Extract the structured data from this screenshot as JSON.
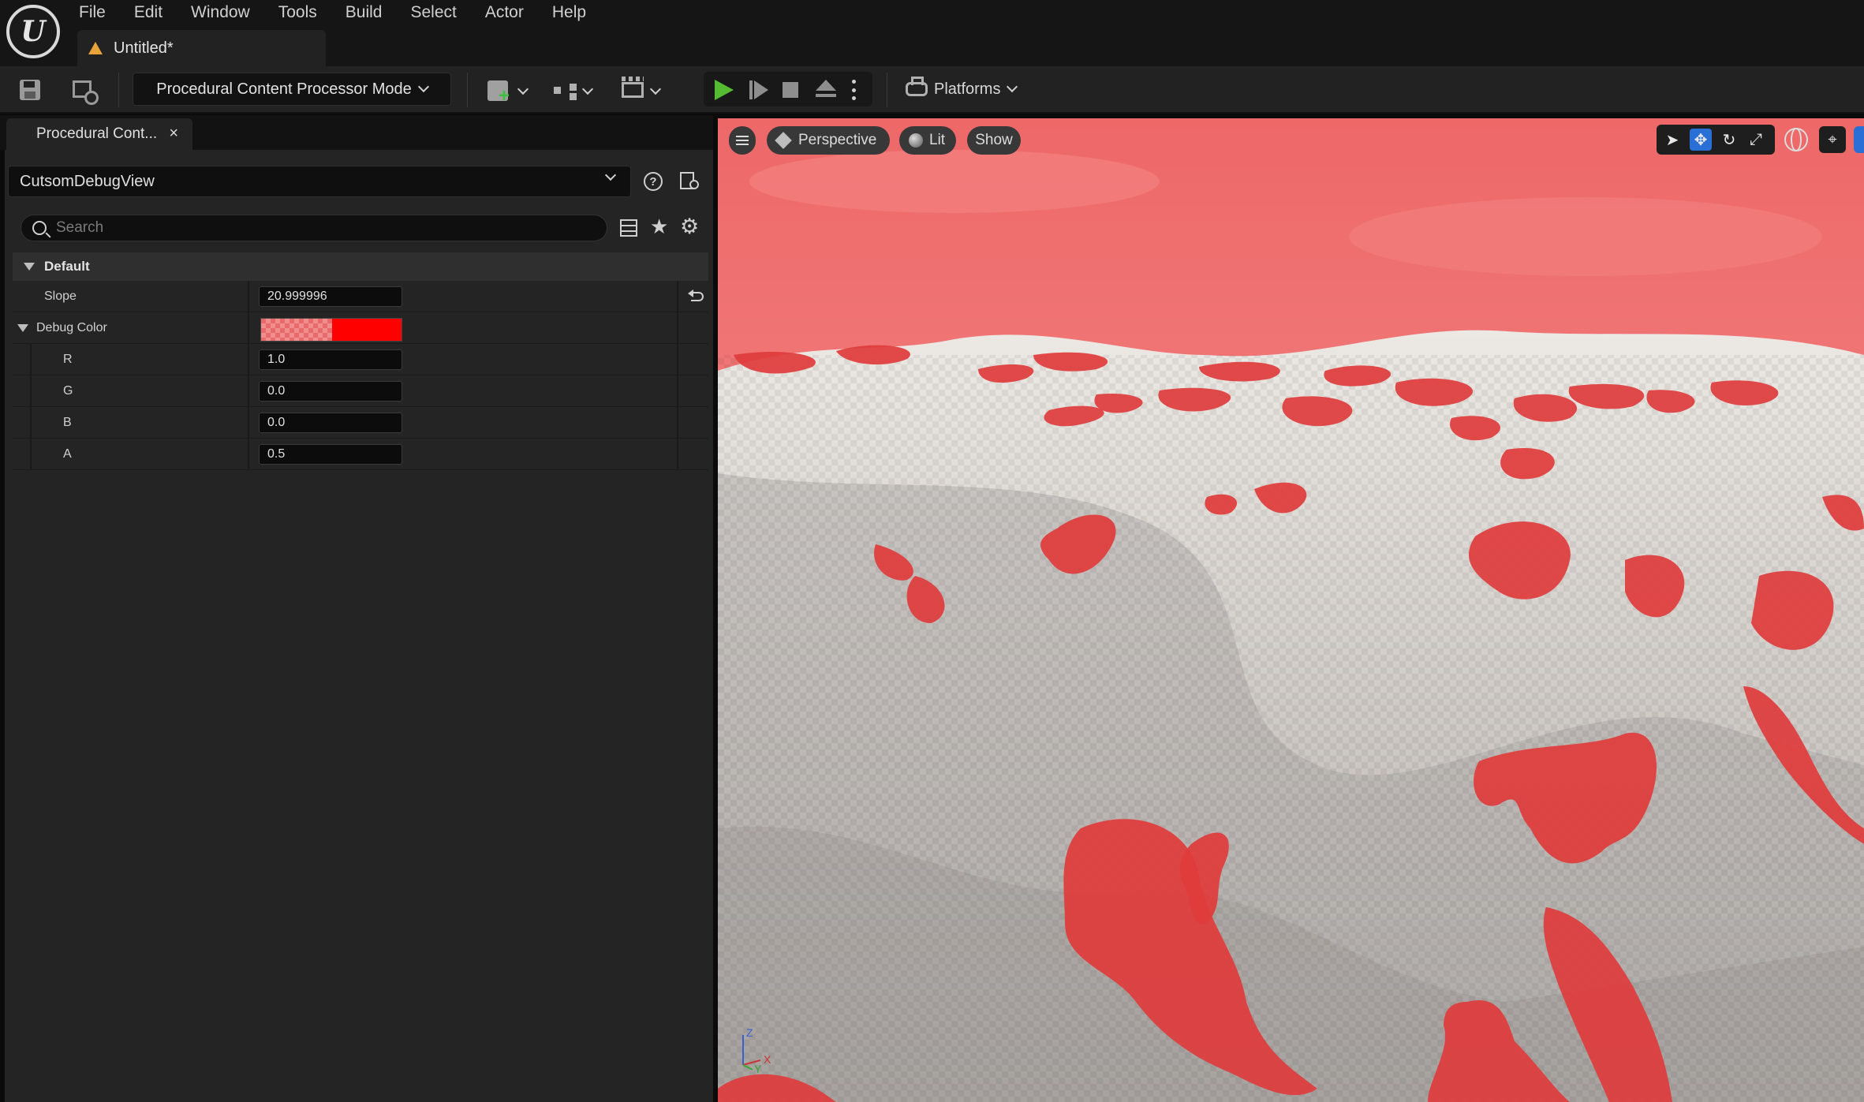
{
  "app": {
    "logo_text": "U",
    "menu": [
      "File",
      "Edit",
      "Window",
      "Tools",
      "Build",
      "Select",
      "Actor",
      "Help"
    ],
    "document_tab": "Untitled*"
  },
  "toolbar": {
    "mode_label": "Procedural Content Processor Mode",
    "platforms_label": "Platforms"
  },
  "panel": {
    "tab_label": "Procedural Cont...",
    "tab_close": "×",
    "object_name": "CutsomDebugView",
    "help_glyph": "?",
    "search_placeholder": "Search",
    "category": "Default",
    "properties": {
      "slope": {
        "label": "Slope",
        "value": "20.999996"
      },
      "debug_color": {
        "label": "Debug Color",
        "swatch_color": "#ff0000",
        "r": {
          "label": "R",
          "value": "1.0"
        },
        "g": {
          "label": "G",
          "value": "0.0"
        },
        "b": {
          "label": "B",
          "value": "0.0"
        },
        "a": {
          "label": "A",
          "value": "0.5"
        }
      }
    }
  },
  "viewport": {
    "view_mode": "Perspective",
    "lighting_mode": "Lit",
    "show_label": "Show",
    "axis_labels": {
      "z": "Z",
      "y": "Y",
      "x": "X"
    },
    "sky_color": "#ee6a6a",
    "highlight_color": "#e03a3a",
    "terrain_color": "#d8d4d0"
  },
  "icons": {
    "favorite": "★",
    "settings": "⚙",
    "select_tool": "➤",
    "translate_tool": "✥",
    "rotate_tool": "↻",
    "scale_tool": "⤢",
    "surface_snap": "⌖"
  }
}
